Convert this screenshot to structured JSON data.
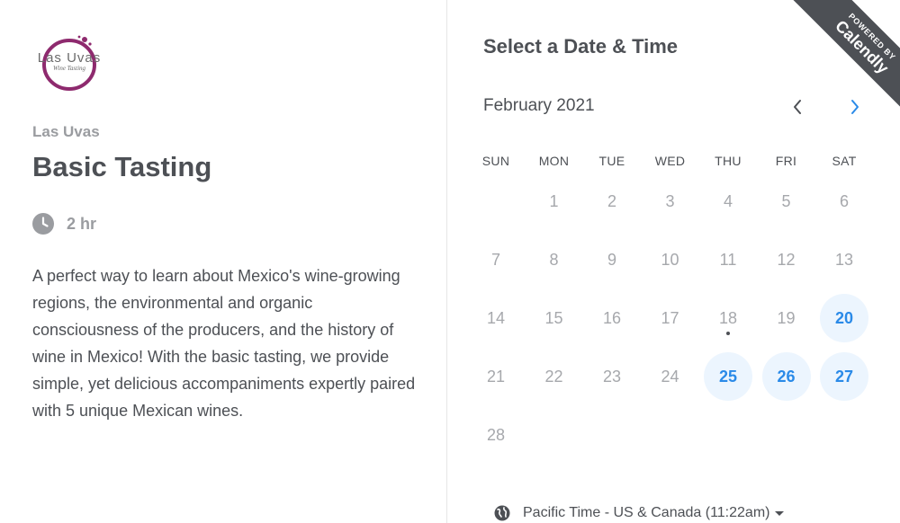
{
  "colors": {
    "text": "#4d5055",
    "muted": "#9a9ca0",
    "accent": "#2a8ae8",
    "accent_bg": "#ecf5fe",
    "logo": "#8e2a6e"
  },
  "event": {
    "logo": {
      "main": "Las Uvas",
      "sub": "Wine Tasting"
    },
    "organizer": "Las Uvas",
    "title": "Basic Tasting",
    "duration_icon": "clock-icon",
    "duration": "2 hr",
    "description": "A perfect way to learn about Mexico's wine-growing regions, the environmental and organic consciousness of the producers, and the history of wine in Mexico! With the basic tasting, we provide simple, yet delicious accompaniments expertly paired with 5 unique Mexican wines."
  },
  "scheduler": {
    "title": "Select a Date & Time",
    "month": "February 2021",
    "nav": {
      "prev_icon": "chevron-left-icon",
      "next_icon": "chevron-right-icon"
    },
    "weekdays": [
      "SUN",
      "MON",
      "TUE",
      "WED",
      "THU",
      "FRI",
      "SAT"
    ],
    "first_weekday_index": 1,
    "days_in_month": 28,
    "today": 18,
    "available_days": [
      20,
      25,
      26,
      27
    ],
    "timezone": {
      "icon": "globe-icon",
      "label": "Pacific Time - US & Canada (11:22am)"
    }
  },
  "badge": {
    "top": "POWERED BY",
    "brand": "Calendly"
  }
}
